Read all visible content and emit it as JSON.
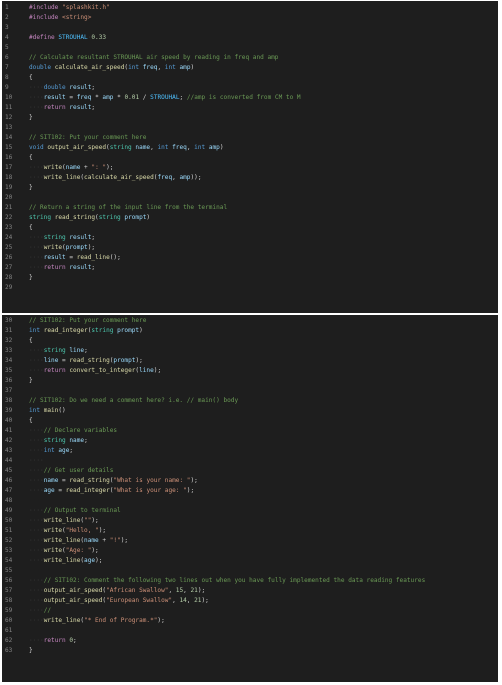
{
  "lines": [
    {
      "n": "1",
      "t": [
        [
          "pp",
          "#include "
        ],
        [
          "str",
          "\"splashkit.h\""
        ]
      ]
    },
    {
      "n": "2",
      "t": [
        [
          "pp",
          "#include "
        ],
        [
          "str",
          "<string>"
        ]
      ]
    },
    {
      "n": "3",
      "t": []
    },
    {
      "n": "4",
      "t": [
        [
          "pp",
          "#define "
        ],
        [
          "mac",
          "STROUHAL"
        ],
        [
          "ws",
          "·"
        ],
        [
          "num",
          "0.33"
        ]
      ]
    },
    {
      "n": "5",
      "t": []
    },
    {
      "n": "6",
      "t": [
        [
          "cm",
          "// Calculate resultant STROUHAL air speed by reading in freq and amp"
        ]
      ]
    },
    {
      "n": "7",
      "t": [
        [
          "kw",
          "double "
        ],
        [
          "fn",
          "calculate_air_speed"
        ],
        [
          "pl",
          "("
        ],
        [
          "kw",
          "int "
        ],
        [
          "var",
          "freq"
        ],
        [
          "pl",
          ", "
        ],
        [
          "kw",
          "int "
        ],
        [
          "var",
          "amp"
        ],
        [
          "pl",
          ")"
        ]
      ]
    },
    {
      "n": "8",
      "t": [
        [
          "pl",
          "{"
        ]
      ]
    },
    {
      "n": "9",
      "t": [
        [
          "ws",
          "····"
        ],
        [
          "kw",
          "double "
        ],
        [
          "var",
          "result"
        ],
        [
          "pl",
          ";"
        ]
      ]
    },
    {
      "n": "10",
      "t": [
        [
          "ws",
          "····"
        ],
        [
          "var",
          "result"
        ],
        [
          "pl",
          " = "
        ],
        [
          "var",
          "freq"
        ],
        [
          "pl",
          " * "
        ],
        [
          "var",
          "amp"
        ],
        [
          "pl",
          " * "
        ],
        [
          "num",
          "0.01"
        ],
        [
          "pl",
          " / "
        ],
        [
          "mac",
          "STROUHAL"
        ],
        [
          "pl",
          "; "
        ],
        [
          "cm",
          "//amp is converted from CM to M"
        ]
      ]
    },
    {
      "n": "11",
      "t": [
        [
          "ws",
          "····"
        ],
        [
          "ctl",
          "return "
        ],
        [
          "var",
          "result"
        ],
        [
          "pl",
          ";"
        ]
      ]
    },
    {
      "n": "12",
      "t": [
        [
          "pl",
          "}"
        ]
      ]
    },
    {
      "n": "13",
      "t": []
    },
    {
      "n": "14",
      "t": [
        [
          "cm",
          "// SIT102: Put your comment here"
        ]
      ]
    },
    {
      "n": "15",
      "t": [
        [
          "kw",
          "void "
        ],
        [
          "fn",
          "output_air_speed"
        ],
        [
          "pl",
          "("
        ],
        [
          "ty",
          "string "
        ],
        [
          "var",
          "name"
        ],
        [
          "pl",
          ", "
        ],
        [
          "kw",
          "int "
        ],
        [
          "var",
          "freq"
        ],
        [
          "pl",
          ", "
        ],
        [
          "kw",
          "int "
        ],
        [
          "var",
          "amp"
        ],
        [
          "pl",
          ")"
        ]
      ]
    },
    {
      "n": "16",
      "t": [
        [
          "pl",
          "{"
        ]
      ]
    },
    {
      "n": "17",
      "t": [
        [
          "ws",
          "····"
        ],
        [
          "fn",
          "write"
        ],
        [
          "pl",
          "("
        ],
        [
          "var",
          "name"
        ],
        [
          "pl",
          " + "
        ],
        [
          "str",
          "\": \""
        ],
        [
          "pl",
          ");"
        ]
      ]
    },
    {
      "n": "18",
      "t": [
        [
          "ws",
          "····"
        ],
        [
          "fn",
          "write_line"
        ],
        [
          "pl",
          "("
        ],
        [
          "fn",
          "calculate_air_speed"
        ],
        [
          "pl",
          "("
        ],
        [
          "var",
          "freq"
        ],
        [
          "pl",
          ", "
        ],
        [
          "var",
          "amp"
        ],
        [
          "pl",
          "));"
        ]
      ]
    },
    {
      "n": "19",
      "t": [
        [
          "pl",
          "}"
        ]
      ]
    },
    {
      "n": "20",
      "t": []
    },
    {
      "n": "21",
      "t": [
        [
          "cm",
          "// Return a string of the input line from the terminal"
        ]
      ]
    },
    {
      "n": "22",
      "t": [
        [
          "ty",
          "string "
        ],
        [
          "fn",
          "read_string"
        ],
        [
          "pl",
          "("
        ],
        [
          "ty",
          "string "
        ],
        [
          "var",
          "prompt"
        ],
        [
          "pl",
          ")"
        ]
      ]
    },
    {
      "n": "23",
      "t": [
        [
          "pl",
          "{"
        ]
      ]
    },
    {
      "n": "24",
      "t": [
        [
          "ws",
          "····"
        ],
        [
          "ty",
          "string "
        ],
        [
          "var",
          "result"
        ],
        [
          "pl",
          ";"
        ]
      ]
    },
    {
      "n": "25",
      "t": [
        [
          "ws",
          "····"
        ],
        [
          "fn",
          "write"
        ],
        [
          "pl",
          "("
        ],
        [
          "var",
          "prompt"
        ],
        [
          "pl",
          ");"
        ]
      ]
    },
    {
      "n": "26",
      "t": [
        [
          "ws",
          "····"
        ],
        [
          "var",
          "result"
        ],
        [
          "pl",
          " = "
        ],
        [
          "fn",
          "read_line"
        ],
        [
          "pl",
          "();"
        ]
      ]
    },
    {
      "n": "27",
      "t": [
        [
          "ws",
          "····"
        ],
        [
          "ctl",
          "return "
        ],
        [
          "var",
          "result"
        ],
        [
          "pl",
          ";"
        ]
      ]
    },
    {
      "n": "28",
      "t": [
        [
          "pl",
          "}"
        ]
      ]
    },
    {
      "n": "29",
      "t": []
    },
    {
      "n": "30",
      "t": [
        [
          "cm",
          "// SIT102: Put your comment here"
        ]
      ]
    },
    {
      "n": "31",
      "t": [
        [
          "kw",
          "int "
        ],
        [
          "fn",
          "read_integer"
        ],
        [
          "pl",
          "("
        ],
        [
          "ty",
          "string "
        ],
        [
          "var",
          "prompt"
        ],
        [
          "pl",
          ")"
        ]
      ]
    },
    {
      "n": "32",
      "t": [
        [
          "pl",
          "{"
        ]
      ]
    },
    {
      "n": "33",
      "t": [
        [
          "ws",
          "····"
        ],
        [
          "ty",
          "string "
        ],
        [
          "var",
          "line"
        ],
        [
          "pl",
          ";"
        ]
      ]
    },
    {
      "n": "34",
      "t": [
        [
          "ws",
          "····"
        ],
        [
          "var",
          "line"
        ],
        [
          "pl",
          " = "
        ],
        [
          "fn",
          "read_string"
        ],
        [
          "pl",
          "("
        ],
        [
          "var",
          "prompt"
        ],
        [
          "pl",
          ");"
        ]
      ]
    },
    {
      "n": "35",
      "t": [
        [
          "ws",
          "····"
        ],
        [
          "ctl",
          "return "
        ],
        [
          "fn",
          "convert_to_integer"
        ],
        [
          "pl",
          "("
        ],
        [
          "var",
          "line"
        ],
        [
          "pl",
          ");"
        ]
      ]
    },
    {
      "n": "36",
      "t": [
        [
          "pl",
          "}"
        ]
      ]
    },
    {
      "n": "37",
      "t": []
    },
    {
      "n": "38",
      "t": [
        [
          "cm",
          "// SIT102: Do we need a comment here? i.e. // main() body"
        ]
      ]
    },
    {
      "n": "39",
      "t": [
        [
          "kw",
          "int "
        ],
        [
          "fn",
          "main"
        ],
        [
          "pl",
          "()"
        ]
      ]
    },
    {
      "n": "40",
      "t": [
        [
          "pl",
          "{"
        ]
      ]
    },
    {
      "n": "41",
      "t": [
        [
          "ws",
          "····"
        ],
        [
          "cm",
          "// Declare variables"
        ]
      ]
    },
    {
      "n": "42",
      "t": [
        [
          "ws",
          "····"
        ],
        [
          "ty",
          "string "
        ],
        [
          "var",
          "name"
        ],
        [
          "pl",
          ";"
        ]
      ]
    },
    {
      "n": "43",
      "t": [
        [
          "ws",
          "····"
        ],
        [
          "kw",
          "int "
        ],
        [
          "var",
          "age"
        ],
        [
          "pl",
          ";"
        ]
      ]
    },
    {
      "n": "44",
      "t": [
        [
          "ws",
          "····"
        ]
      ]
    },
    {
      "n": "45",
      "t": [
        [
          "ws",
          "····"
        ],
        [
          "cm",
          "// Get user details"
        ]
      ]
    },
    {
      "n": "46",
      "t": [
        [
          "ws",
          "····"
        ],
        [
          "var",
          "name"
        ],
        [
          "pl",
          " = "
        ],
        [
          "fn",
          "read_string"
        ],
        [
          "pl",
          "("
        ],
        [
          "str",
          "\"What is your name: \""
        ],
        [
          "pl",
          ");"
        ]
      ]
    },
    {
      "n": "47",
      "t": [
        [
          "ws",
          "····"
        ],
        [
          "var",
          "age"
        ],
        [
          "pl",
          " = "
        ],
        [
          "fn",
          "read_integer"
        ],
        [
          "pl",
          "("
        ],
        [
          "str",
          "\"What is your age: \""
        ],
        [
          "pl",
          ");"
        ]
      ]
    },
    {
      "n": "48",
      "t": []
    },
    {
      "n": "49",
      "t": [
        [
          "ws",
          "····"
        ],
        [
          "cm",
          "// Output to terminal"
        ]
      ]
    },
    {
      "n": "50",
      "t": [
        [
          "ws",
          "····"
        ],
        [
          "fn",
          "write_line"
        ],
        [
          "pl",
          "("
        ],
        [
          "str",
          "\"\""
        ],
        [
          "pl",
          ");"
        ]
      ]
    },
    {
      "n": "51",
      "t": [
        [
          "ws",
          "····"
        ],
        [
          "fn",
          "write"
        ],
        [
          "pl",
          "("
        ],
        [
          "str",
          "\"Hello, \""
        ],
        [
          "pl",
          ");"
        ]
      ]
    },
    {
      "n": "52",
      "t": [
        [
          "ws",
          "····"
        ],
        [
          "fn",
          "write_line"
        ],
        [
          "pl",
          "("
        ],
        [
          "var",
          "name"
        ],
        [
          "pl",
          " + "
        ],
        [
          "str",
          "\"!\""
        ],
        [
          "pl",
          ");"
        ]
      ]
    },
    {
      "n": "53",
      "t": [
        [
          "ws",
          "····"
        ],
        [
          "fn",
          "write"
        ],
        [
          "pl",
          "("
        ],
        [
          "str",
          "\"Age: \""
        ],
        [
          "pl",
          ");"
        ]
      ]
    },
    {
      "n": "54",
      "t": [
        [
          "ws",
          "····"
        ],
        [
          "fn",
          "write_line"
        ],
        [
          "pl",
          "("
        ],
        [
          "var",
          "age"
        ],
        [
          "pl",
          ");"
        ]
      ]
    },
    {
      "n": "55",
      "t": []
    },
    {
      "n": "56",
      "t": [
        [
          "ws",
          "····"
        ],
        [
          "cm",
          "// SIT102: Comment the following two lines out when you have fully implemented the data reading features"
        ]
      ]
    },
    {
      "n": "57",
      "t": [
        [
          "ws",
          "····"
        ],
        [
          "fn",
          "output_air_speed"
        ],
        [
          "pl",
          "("
        ],
        [
          "str",
          "\"African Swallow\""
        ],
        [
          "pl",
          ", "
        ],
        [
          "num",
          "15"
        ],
        [
          "pl",
          ", "
        ],
        [
          "num",
          "21"
        ],
        [
          "pl",
          ");"
        ]
      ]
    },
    {
      "n": "58",
      "t": [
        [
          "ws",
          "····"
        ],
        [
          "fn",
          "output_air_speed"
        ],
        [
          "pl",
          "("
        ],
        [
          "str",
          "\"European Swallow\""
        ],
        [
          "pl",
          ", "
        ],
        [
          "num",
          "14"
        ],
        [
          "pl",
          ", "
        ],
        [
          "num",
          "21"
        ],
        [
          "pl",
          ");"
        ]
      ]
    },
    {
      "n": "59",
      "t": [
        [
          "ws",
          "····"
        ],
        [
          "cm",
          "//"
        ]
      ]
    },
    {
      "n": "60",
      "t": [
        [
          "ws",
          "····"
        ],
        [
          "fn",
          "write_line"
        ],
        [
          "pl",
          "("
        ],
        [
          "str",
          "\"* End of Program.*\""
        ],
        [
          "pl",
          ");"
        ]
      ]
    },
    {
      "n": "61",
      "t": []
    },
    {
      "n": "62",
      "t": [
        [
          "ws",
          "····"
        ],
        [
          "ctl",
          "return "
        ],
        [
          "num",
          "0"
        ],
        [
          "pl",
          ";"
        ]
      ]
    },
    {
      "n": "63",
      "t": [
        [
          "pl",
          "}"
        ]
      ]
    }
  ]
}
